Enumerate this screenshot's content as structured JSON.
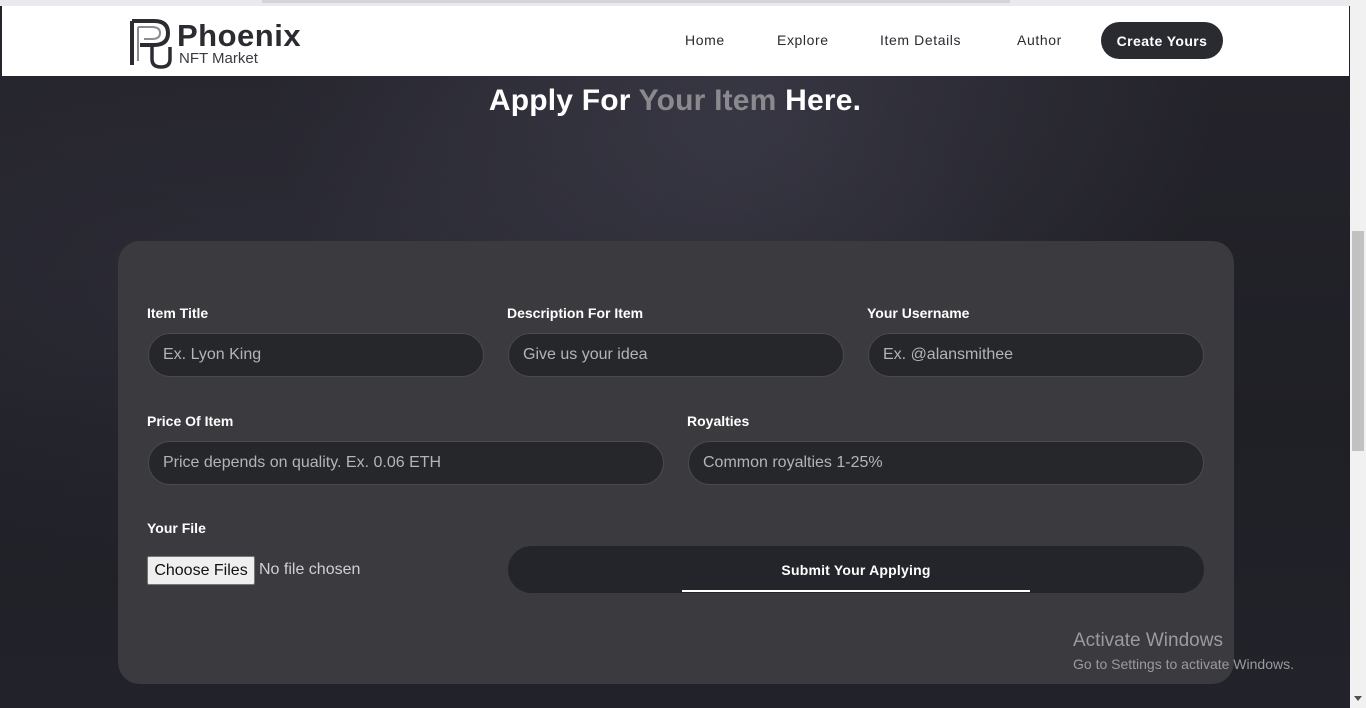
{
  "header": {
    "logo_name": "Phoenix",
    "logo_sub": "NFT Market",
    "nav": [
      "Home",
      "Explore",
      "Item Details",
      "Author"
    ],
    "cta": "Create Yours"
  },
  "page_title": {
    "part1": "Apply For ",
    "accent": "Your Item",
    "part2": " Here."
  },
  "form": {
    "item_title_label": "Item Title",
    "item_title_placeholder": "Ex. Lyon King",
    "description_label": "Description For Item",
    "description_placeholder": "Give us your idea",
    "username_label": "Your Username",
    "username_placeholder": "Ex. @alansmithee",
    "price_label": "Price Of Item",
    "price_placeholder": "Price depends on quality. Ex. 0.06 ETH",
    "royalties_label": "Royalties",
    "royalties_placeholder": "Common royalties 1-25%",
    "file_label": "Your File",
    "choose_button": "Choose Files",
    "no_file": "No file chosen",
    "submit": "Submit Your Applying"
  },
  "watermark": {
    "line1": "Activate Windows",
    "line2": "Go to Settings to activate Windows."
  },
  "colors": {
    "card": "#3a3a3f",
    "field": "#26272b",
    "accent_text": "#8a8a8e",
    "cta": "#2a2b30"
  }
}
